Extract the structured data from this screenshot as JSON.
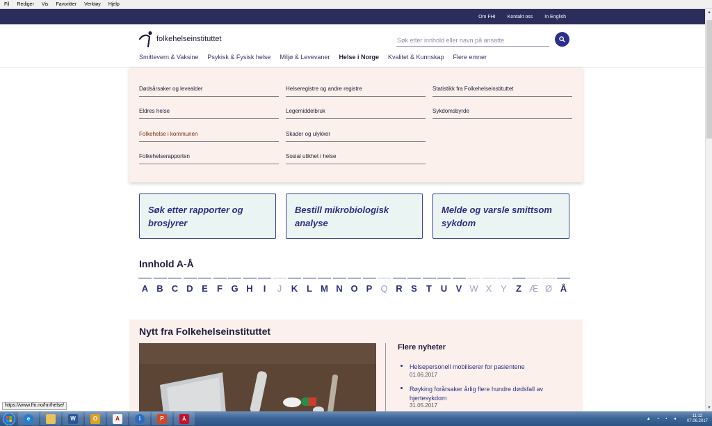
{
  "browser": {
    "menu": [
      "Fil",
      "Rediger",
      "Vis",
      "Favoritter",
      "Verktøy",
      "Hjelp"
    ],
    "status_url": "https://www.fhi.no/hn/helse/"
  },
  "topbar": {
    "links": [
      "Om FHI",
      "Kontakt oss",
      "In English"
    ]
  },
  "header": {
    "logo_text": "folkehelseinstituttet",
    "search_placeholder": "Søk etter innhold eller navn på ansatte"
  },
  "nav": {
    "items": [
      "Smittevern & Vaksine",
      "Psykisk & Fysisk helse",
      "Miljø & Levevaner",
      "Helse i Norge",
      "Kvalitet & Kunnskap",
      "Flere emner"
    ],
    "active_index": 3
  },
  "mega_menu": {
    "col1": [
      "Dødsårsaker og levealder",
      "Eldres helse",
      "Folkehelse i kommunen",
      "Folkehelserapporten"
    ],
    "col2": [
      "Helseregistre og andre registre",
      "Legemiddelbruk",
      "Skader og ulykker",
      "Sosial ulikhet i helse"
    ],
    "col3": [
      "Statistikk fra Folkehelseinstituttet",
      "Sykdomsbyrde"
    ],
    "hover_color": "#7a2a0e"
  },
  "cards": [
    "Søk etter rapporter og brosjyrer",
    "Bestill mikrobiologisk analyse",
    "Melde og varsle smittsom sykdom"
  ],
  "az": {
    "title": "Innhold A-Å",
    "letters": [
      "A",
      "B",
      "C",
      "D",
      "E",
      "F",
      "G",
      "H",
      "I",
      "J",
      "K",
      "L",
      "M",
      "N",
      "O",
      "P",
      "Q",
      "R",
      "S",
      "T",
      "U",
      "V",
      "W",
      "X",
      "Y",
      "Z",
      "Æ",
      "Ø",
      "Å"
    ],
    "disabled": [
      "J",
      "Q",
      "W",
      "X",
      "Y",
      "Æ",
      "Ø"
    ]
  },
  "news": {
    "title": "Nytt fra Folkehelseinstituttet",
    "more_title": "Flere nyheter",
    "items": [
      {
        "text": "Helsepersonell mobiliserer for pasientene",
        "date": "01.06.2017"
      },
      {
        "text": "Røyking forårsaker årlig flere hundre dødsfall av hjertesykdom",
        "date": "31.05.2017"
      }
    ]
  },
  "taskbar": {
    "apps": [
      "ie-icon",
      "explorer-icon",
      "word-icon",
      "outlook-icon",
      "acrobat-icon",
      "citrix-icon",
      "powerpoint-icon",
      "pdf-icon"
    ],
    "time": "11:12",
    "date": "07.06.2017"
  },
  "colors": {
    "primary": "#2a2f80",
    "topbar": "#2b2d5c",
    "mega_bg": "#fbf0ec",
    "card_bg": "#eaf4f3"
  }
}
